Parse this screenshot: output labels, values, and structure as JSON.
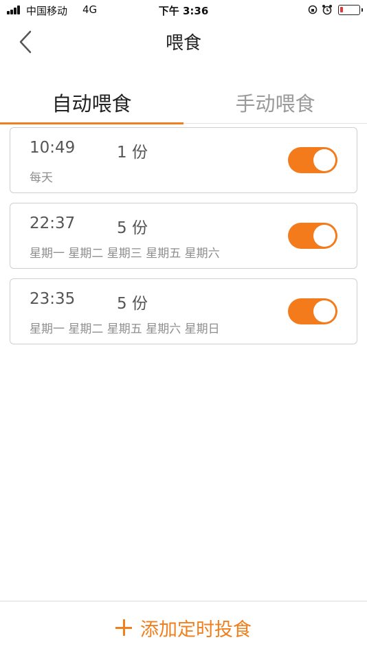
{
  "status_bar": {
    "carrier": "中国移动",
    "network": "4G",
    "time": "下午 3:36",
    "battery_color": "#e53935"
  },
  "nav": {
    "title": "喂食",
    "back_icon": "chevron-left-icon"
  },
  "tabs": [
    {
      "label": "自动喂食",
      "active": true
    },
    {
      "label": "手动喂食",
      "active": false
    }
  ],
  "schedules": [
    {
      "time": "10:49",
      "portion": "1 份",
      "days": "每天",
      "enabled": true
    },
    {
      "time": "22:37",
      "portion": "5 份",
      "days": "星期一 星期二 星期三 星期五 星期六",
      "enabled": true
    },
    {
      "time": "23:35",
      "portion": "5 份",
      "days": "星期一 星期二 星期五 星期六 星期日",
      "enabled": true
    }
  ],
  "bottom": {
    "add_label": "添加定时投食",
    "add_icon": "plus-icon"
  },
  "colors": {
    "accent": "#f47b1c",
    "text_primary": "#222222",
    "text_secondary": "#8e8e8e"
  }
}
